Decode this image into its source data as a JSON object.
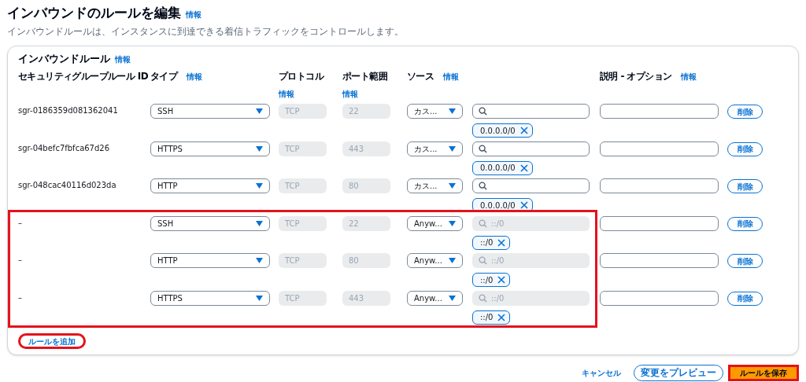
{
  "page": {
    "title": "インバウンドのルールを編集",
    "info_link": "情報",
    "description": "インバウンドルールは、インスタンスに到達できる着信トラフィックをコントロールします。"
  },
  "panel": {
    "title": "インバウンドルール",
    "info_link": "情報"
  },
  "columns": [
    {
      "label": "セキュリティグループルール ID"
    },
    {
      "label": "タイプ",
      "info_link": "情報",
      "info_below": false
    },
    {
      "label": "プロトコル",
      "info_link": "情報",
      "info_below": true
    },
    {
      "label": "ポート範囲",
      "info_link": "情報",
      "info_below": true
    },
    {
      "label": "ソース",
      "info_link": "情報",
      "info_below": false
    },
    {},
    {
      "label": "説明 - オプション",
      "info_link": "情報",
      "info_below": false
    }
  ],
  "existing_rules": [
    {
      "id": "sgr-0186359d081362041",
      "type": "SSH",
      "protocol": "TCP",
      "port": "22",
      "source": "カス...",
      "cidr": {
        "disabled": false
      },
      "chip": "0.0.0.0/0",
      "delete": "削除"
    },
    {
      "id": "sgr-04befc7fbfca67d26",
      "type": "HTTPS",
      "protocol": "TCP",
      "port": "443",
      "source": "カス...",
      "cidr": {
        "disabled": false
      },
      "chip": "0.0.0.0/0",
      "delete": "削除"
    },
    {
      "id": "sgr-048cac40116d023da",
      "type": "HTTP",
      "protocol": "TCP",
      "port": "80",
      "source": "カス...",
      "cidr": {
        "disabled": false
      },
      "chip": "0.0.0.0/0",
      "delete": "削除"
    }
  ],
  "new_rules_highlighted": true,
  "new_rules": [
    {
      "id": "–",
      "type": "SSH",
      "protocol": "TCP",
      "port": "22",
      "source": "Anyw...",
      "cidr": {
        "placeholder": "::/0",
        "disabled": true
      },
      "chip": "::/0",
      "delete": "削除"
    },
    {
      "id": "–",
      "type": "HTTP",
      "protocol": "TCP",
      "port": "80",
      "source": "Anyw...",
      "cidr": {
        "placeholder": "::/0",
        "disabled": true
      },
      "chip": "::/0",
      "delete": "削除"
    },
    {
      "id": "–",
      "type": "HTTPS",
      "protocol": "TCP",
      "port": "443",
      "source": "Anyw...",
      "cidr": {
        "placeholder": "::/0",
        "disabled": true
      },
      "chip": "::/0",
      "delete": "削除"
    }
  ],
  "add_rule": {
    "label": "ルールを追加",
    "highlighted": true
  },
  "footer": [
    {
      "kind": "link",
      "label": "キャンセル",
      "highlighted": false
    },
    {
      "kind": "secondary",
      "label": "変更をプレビュー",
      "highlighted": false
    },
    {
      "kind": "primary",
      "label": "ルールを保存",
      "highlighted": true
    }
  ]
}
